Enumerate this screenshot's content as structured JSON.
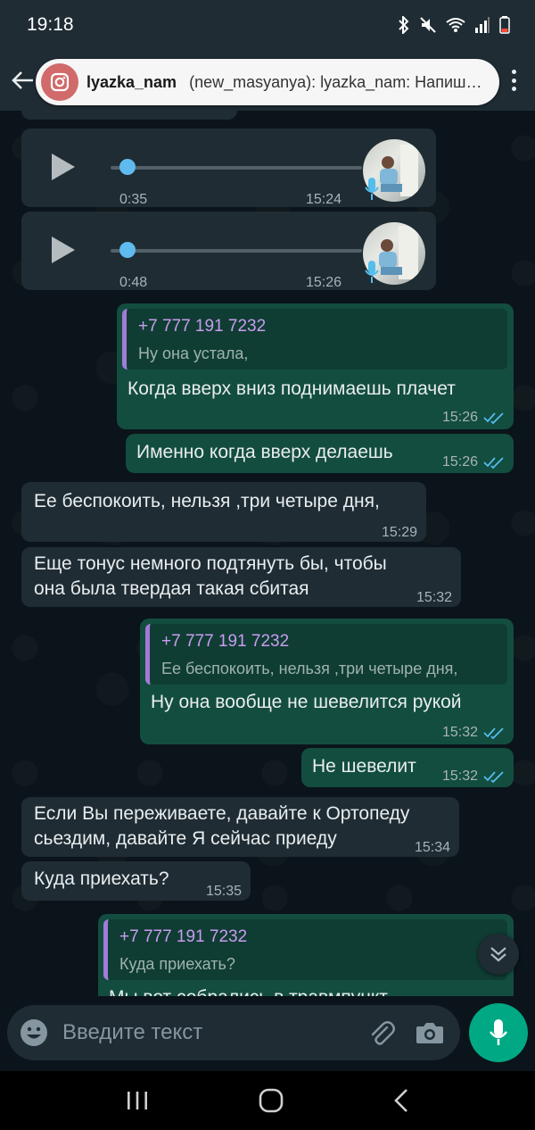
{
  "status_bar": {
    "time": "19:18"
  },
  "notification": {
    "app_name": "lyazka_nam",
    "text": "(new_masyanya): lyazka_nam: Напиш…"
  },
  "messages": {
    "voice1": {
      "duration": "0:35",
      "time": "15:24"
    },
    "voice2": {
      "duration": "0:48",
      "time": "15:26"
    },
    "m1": {
      "quote_name": "+7 777 191 7232",
      "quote_text": "Ну она устала,",
      "text": "Когда вверх вниз поднимаешь плачет",
      "time": "15:26"
    },
    "m2": {
      "text": "Именно когда вверх делаешь",
      "time": "15:26"
    },
    "m3": {
      "text": "Ее беспокоить, нельзя ,три четыре дня,",
      "time": "15:29"
    },
    "m4": {
      "line1": "Еще тонус немного подтянуть бы, чтобы",
      "line2": "она была твердая такая сбитая",
      "time": "15:32"
    },
    "m5": {
      "quote_name": "+7 777 191 7232",
      "quote_text": "Ее беспокоить, нельзя ,три четыре дня,",
      "text": "Ну она вообще не шевелится рукой",
      "time": "15:32"
    },
    "m6": {
      "text": "Не шевелит",
      "time": "15:32"
    },
    "m7": {
      "line1": "Если Вы переживаете, давайте к Ортопеду",
      "line2": "сьездим, давайте Я сейчас приеду",
      "time": "15:34"
    },
    "m8": {
      "text": "Куда приехать?",
      "time": "15:35"
    },
    "m9": {
      "quote_name": "+7 777 191 7232",
      "quote_text": "Куда приехать?",
      "text": "Мы вот собрались в травмпункт"
    }
  },
  "composer": {
    "placeholder": "Введите текст"
  },
  "colors": {
    "bubble_in": "#1f2c33",
    "bubble_out": "#134d40",
    "accent": "#00a884",
    "quote_bar": "#a37bd6",
    "read_ticks": "#53bdeb"
  }
}
